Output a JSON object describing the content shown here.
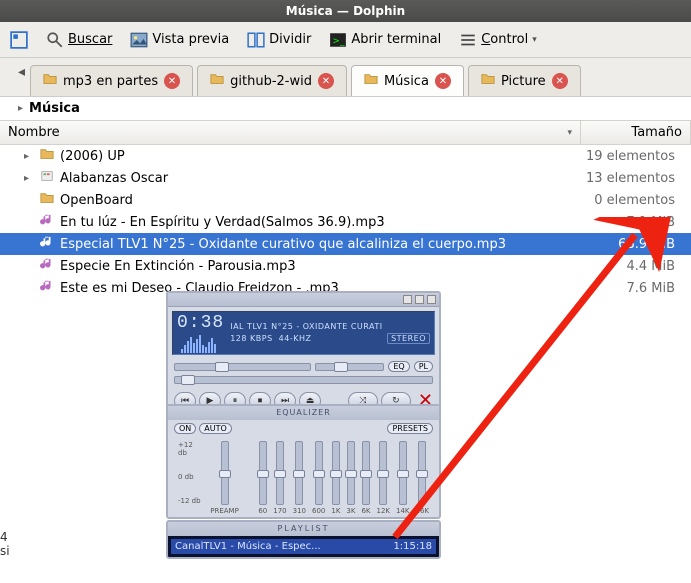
{
  "window": {
    "title": "Música — Dolphin"
  },
  "toolbar": {
    "search": "Buscar",
    "preview": "Vista previa",
    "split": "Dividir",
    "terminal": "Abrir terminal",
    "control": "Control"
  },
  "tabs": [
    {
      "label": "mp3 en partes",
      "active": false
    },
    {
      "label": "github-2-wid",
      "active": false
    },
    {
      "label": "Música",
      "active": true
    },
    {
      "label": "Picture",
      "active": false
    }
  ],
  "breadcrumb": {
    "location": "Música"
  },
  "columns": {
    "name": "Nombre",
    "size": "Tamaño"
  },
  "files": [
    {
      "type": "folder",
      "expandable": true,
      "name": "(2006) UP",
      "size": "19 elementos"
    },
    {
      "type": "folder",
      "expandable": true,
      "name": "Alabanzas Oscar",
      "size": "13 elementos",
      "icon": "fancy"
    },
    {
      "type": "folder",
      "expandable": false,
      "name": "OpenBoard",
      "size": "0 elementos"
    },
    {
      "type": "music",
      "expandable": false,
      "name": "En tu lúz - En Espíritu y Verdad(Salmos 36.9).mp3",
      "size": "7.1 MiB"
    },
    {
      "type": "music",
      "expandable": false,
      "name": "Especial TLV1 N°25 - Oxidante curativo que alcaliniza el cuerpo.mp3",
      "size": "68.9 MiB",
      "selected": true
    },
    {
      "type": "music",
      "expandable": false,
      "name": "Especie En Extinción - Parousia.mp3",
      "size": "4.4 MiB"
    },
    {
      "type": "music",
      "expandable": false,
      "name": "Este es mi Deseo - Claudio Freidzon - .mp3",
      "size": "7.6 MiB"
    }
  ],
  "player": {
    "time": "0:38",
    "track_scroll": "IAL TLV1 N°25 - OXIDANTE CURATI",
    "bitrate": "128 KBPS",
    "khz_label": "44",
    "khz_suffix": "-KHZ",
    "stereo": "STEREO",
    "eq_btn": "EQ",
    "pl_btn": "PL"
  },
  "equalizer": {
    "title": "EQUALIZER",
    "on": "ON",
    "auto": "AUTO",
    "presets": "PRESETS",
    "scale_top": "+12 db",
    "scale_mid": "0 db",
    "scale_bot": "-12 db",
    "preamp": "PREAMP",
    "bands": [
      "60",
      "170",
      "310",
      "600",
      "1K",
      "3K",
      "6K",
      "12K",
      "14K",
      "16K"
    ]
  },
  "playlist": {
    "title": "PLAYLIST",
    "item_text": "CanalTLV1 - Música - Espec...",
    "item_time": "1:15:18"
  },
  "side": {
    "four": "4",
    "si": "si"
  }
}
